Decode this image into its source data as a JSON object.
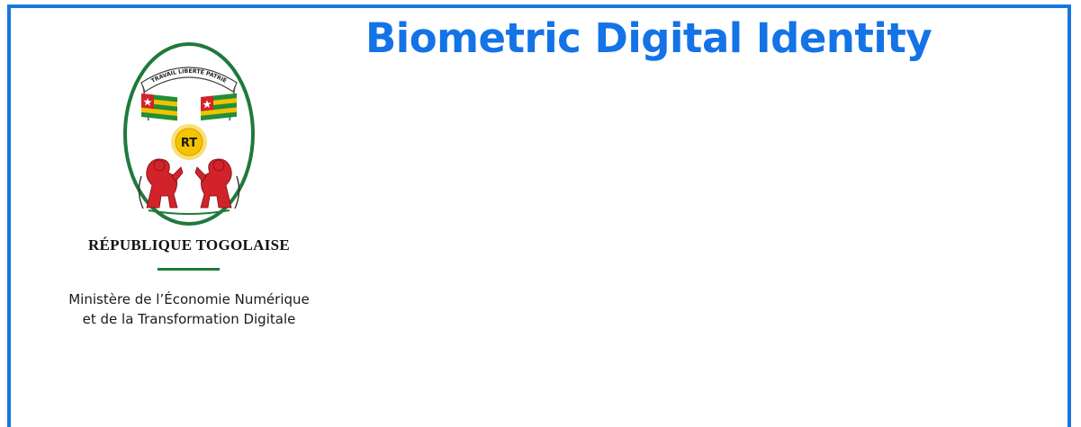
{
  "header": {
    "title": "Biometric Digital Identity"
  },
  "emblem": {
    "icon": "togo-coat-of-arms-icon",
    "motto": "TRAVAIL LIBERTÉ PATRIE",
    "initials": "RT"
  },
  "country": {
    "name": "RÉPUBLIQUE TOGOLAISE"
  },
  "ministry": {
    "line1": "Ministère de l’Économie Numérique",
    "line2": "et de la Transformation Digitale"
  },
  "colors": {
    "accent": "#1473e6",
    "frame": "#1877e0",
    "divider": "#1f7a3a",
    "flag_green": "#1f8f3a",
    "flag_yellow": "#f2c200",
    "flag_red": "#d3232a",
    "sun": "#f5c400"
  }
}
